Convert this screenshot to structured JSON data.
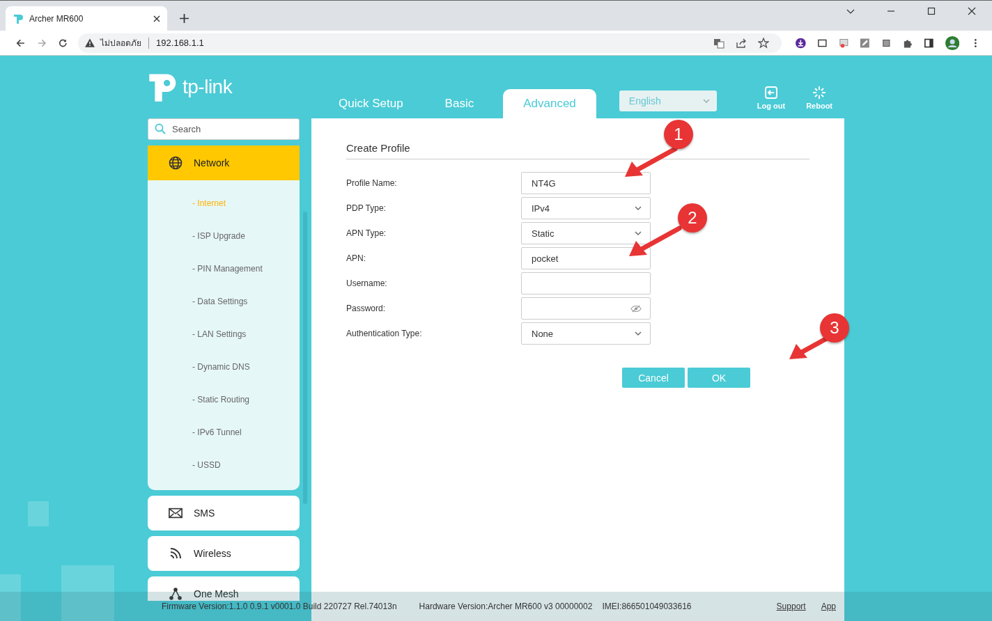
{
  "browser": {
    "tab_title": "Archer MR600",
    "security_label": "ไม่ปลอดภัย",
    "address": "192.168.1.1"
  },
  "header": {
    "logo_text": "tp-link",
    "nav_tabs": [
      {
        "label": "Quick Setup",
        "selected": false
      },
      {
        "label": "Basic",
        "selected": false
      },
      {
        "label": "Advanced",
        "selected": true
      }
    ],
    "language": "English",
    "actions": [
      {
        "kind": "logout",
        "label": "Log out"
      },
      {
        "kind": "reboot",
        "label": "Reboot"
      }
    ]
  },
  "sidebar": {
    "search": {
      "placeholder": "Search"
    },
    "sections": [
      {
        "kind": "globe",
        "label": "Network",
        "expanded": true,
        "children": [
          {
            "label": "- Internet",
            "selected": true
          },
          {
            "label": "- ISP Upgrade",
            "selected": false
          },
          {
            "label": "- PIN Management",
            "selected": false
          },
          {
            "label": "- Data Settings",
            "selected": false
          },
          {
            "label": "- LAN Settings",
            "selected": false
          },
          {
            "label": "- Dynamic DNS",
            "selected": false
          },
          {
            "label": "- Static Routing",
            "selected": false
          },
          {
            "label": "- IPv6 Tunnel",
            "selected": false
          },
          {
            "label": "- USSD",
            "selected": false
          }
        ]
      },
      {
        "kind": "mail",
        "label": "SMS",
        "expanded": false
      },
      {
        "kind": "wifi",
        "label": "Wireless",
        "expanded": false
      },
      {
        "kind": "mesh",
        "label": "One Mesh",
        "expanded": false
      }
    ]
  },
  "form": {
    "title": "Create Profile",
    "fields": [
      {
        "kind": "text",
        "label": "Profile Name:",
        "value": "NT4G"
      },
      {
        "kind": "select",
        "label": "PDP Type:",
        "value": "IPv4"
      },
      {
        "kind": "select",
        "label": "APN Type:",
        "value": "Static"
      },
      {
        "kind": "text",
        "label": "APN:",
        "value": "pocket"
      },
      {
        "kind": "text",
        "label": "Username:"
      },
      {
        "kind": "password",
        "label": "Password:"
      },
      {
        "kind": "select",
        "label": "Authentication Type:",
        "value": "None"
      }
    ],
    "buttons": [
      "Cancel",
      "OK"
    ]
  },
  "callouts": [
    "1",
    "2",
    "3"
  ],
  "footer": {
    "firmware": "Firmware Version:1.1.0 0.9.1 v0001.0 Build 220727 Rel.74013n",
    "hardware": "Hardware Version:Archer MR600 v3 00000002",
    "imei": "IMEI:866501049033616",
    "links": [
      "Support",
      "App"
    ]
  }
}
